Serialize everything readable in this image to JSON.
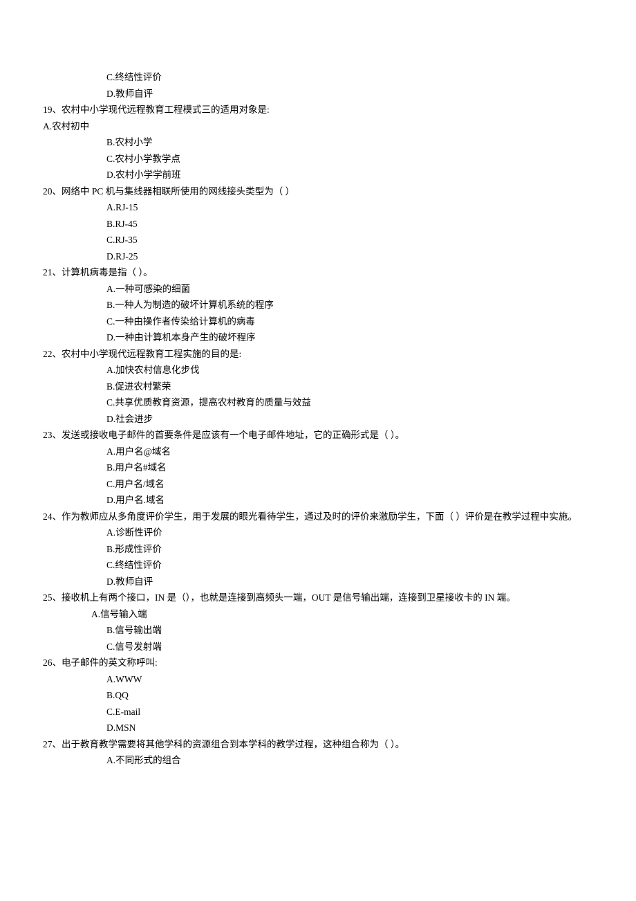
{
  "lines": [
    {
      "cls": "opt-indent",
      "text": "C.终结性评价"
    },
    {
      "cls": "opt-indent",
      "text": "D.教师自评"
    },
    {
      "cls": "q",
      "text": "19、农村中小学现代远程教育工程模式三的适用对象是:"
    },
    {
      "cls": "q",
      "text": "A.农村初中"
    },
    {
      "cls": "opt-indent",
      "text": "B.农村小学"
    },
    {
      "cls": "opt-indent",
      "text": "C.农村小学教学点"
    },
    {
      "cls": "opt-indent",
      "text": "D.农村小学学前班"
    },
    {
      "cls": "q",
      "text": "20、网络中 PC 机与集线器相联所使用的网线接头类型为（          ）"
    },
    {
      "cls": "opt-indent",
      "text": "A.RJ-15"
    },
    {
      "cls": "opt-indent",
      "text": "B.RJ-45"
    },
    {
      "cls": "opt-indent",
      "text": "C.RJ-35"
    },
    {
      "cls": "opt-indent",
      "text": "D.RJ-25"
    },
    {
      "cls": "q",
      "text": "21、计算机病毒是指（              ）。"
    },
    {
      "cls": "opt-indent",
      "text": "A.一种可感染的细菌"
    },
    {
      "cls": "opt-indent",
      "text": "B.一种人为制造的破坏计算机系统的程序"
    },
    {
      "cls": "opt-indent",
      "text": "C.一种由操作者传染给计算机的病毒"
    },
    {
      "cls": "opt-indent",
      "text": "D.一种由计算机本身产生的破坏程序"
    },
    {
      "cls": "q",
      "text": "22、农村中小学现代远程教育工程实施的目的是:"
    },
    {
      "cls": "opt-indent",
      "text": "A.加快农村信息化步伐"
    },
    {
      "cls": "opt-indent",
      "text": "B.促进农村繁荣"
    },
    {
      "cls": "opt-indent",
      "text": "C.共享优质教育资源，提高农村教育的质量与效益"
    },
    {
      "cls": "opt-indent",
      "text": "D.社会进步"
    },
    {
      "cls": "q",
      "text": "23、发送或接收电子邮件的首要条件是应该有一个电子邮件地址，它的正确形式是（     ）。"
    },
    {
      "cls": "opt-indent",
      "text": "A.用户名@域名"
    },
    {
      "cls": "opt-indent",
      "text": "B.用户名#域名"
    },
    {
      "cls": "opt-indent",
      "text": "C.用户名/域名"
    },
    {
      "cls": "opt-indent",
      "text": "D.用户名.域名"
    },
    {
      "cls": "q",
      "text": "24、作为教师应从多角度评价学生，用于发展的眼光看待学生，通过及时的评价来激励学生，下面（    ）评价是在教学过程中实施。"
    },
    {
      "cls": "opt-indent",
      "text": "A.诊断性评价"
    },
    {
      "cls": "opt-indent",
      "text": "B.形成性评价"
    },
    {
      "cls": "opt-indent",
      "text": "C.终结性评价"
    },
    {
      "cls": "opt-indent",
      "text": "D.教师自评"
    },
    {
      "cls": "q",
      "text": "25、接收机上有两个接口，IN 是（），也就是连接到高频头一端，OUT 是信号输出端，连接到卫星接收卡的 IN 端。"
    },
    {
      "cls": "q",
      "text": " "
    },
    {
      "cls": "opt-indent2",
      "text": "A.信号输入端"
    },
    {
      "cls": "opt-indent",
      "text": "B.信号输出端"
    },
    {
      "cls": "opt-indent",
      "text": "C.信号发射端"
    },
    {
      "cls": "q",
      "text": "26、电子邮件的英文称呼叫:"
    },
    {
      "cls": "opt-indent",
      "text": "A.WWW"
    },
    {
      "cls": "opt-indent",
      "text": "B.QQ"
    },
    {
      "cls": "opt-indent",
      "text": "C.E-mail"
    },
    {
      "cls": "opt-indent",
      "text": "D.MSN"
    },
    {
      "cls": "q",
      "text": "27、出于教育教学需要将其他学科的资源组合到本学科的教学过程，这种组合称为（      ）。"
    },
    {
      "cls": "opt-indent",
      "text": "A.不同形式的组合"
    }
  ]
}
